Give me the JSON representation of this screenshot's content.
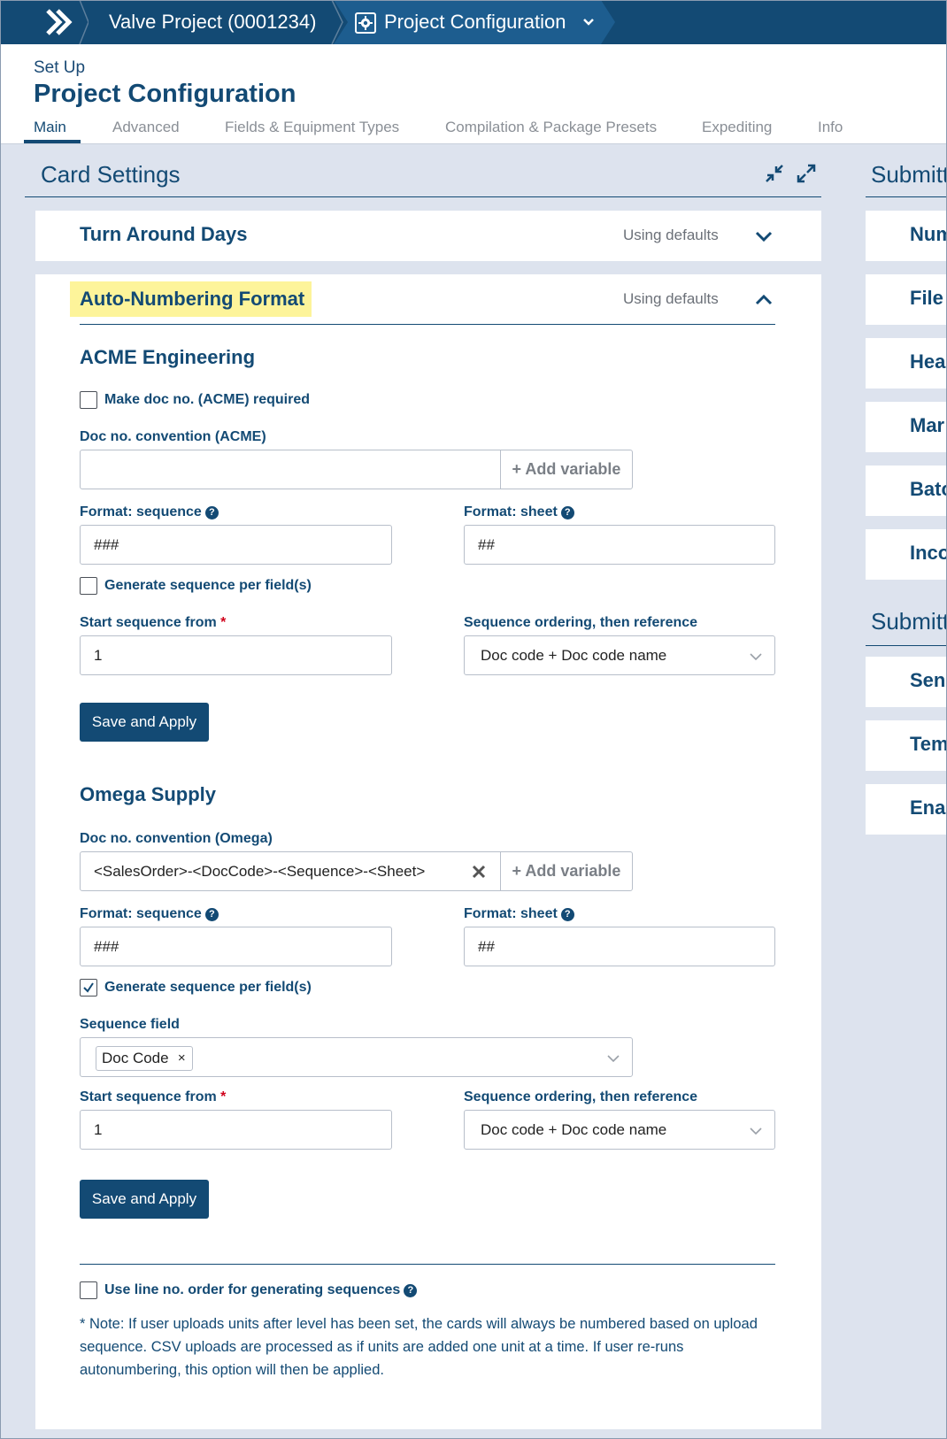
{
  "topbar": {
    "project": "Valve Project (0001234)",
    "page": "Project Configuration"
  },
  "header": {
    "setup": "Set Up",
    "title": "Project Configuration",
    "tabs": [
      "Main",
      "Advanced",
      "Fields & Equipment Types",
      "Compilation & Package Presets",
      "Expediting",
      "Info"
    ]
  },
  "panel": {
    "title": "Card Settings",
    "turn_around": {
      "title": "Turn Around Days",
      "status": "Using defaults"
    },
    "auto_numbering": {
      "title": "Auto-Numbering Format",
      "status": "Using defaults",
      "acme": {
        "title": "ACME Engineering",
        "make_required": "Make doc no. (ACME) required",
        "convention_label": "Doc no. convention (ACME)",
        "convention_value": "",
        "add_variable": "+ Add variable",
        "format_sequence_label": "Format: sequence",
        "format_sequence_value": "###",
        "format_sheet_label": "Format: sheet",
        "format_sheet_value": "##",
        "generate_per_field": "Generate sequence per field(s)",
        "start_label": "Start sequence from",
        "start_value": "1",
        "ordering_label": "Sequence ordering, then reference",
        "ordering_value": "Doc code + Doc code name",
        "save": "Save and Apply"
      },
      "omega": {
        "title": "Omega Supply",
        "convention_label": "Doc no. convention (Omega)",
        "convention_value": "<SalesOrder>-<DocCode>-<Sequence>-<Sheet>",
        "add_variable": "+ Add variable",
        "format_sequence_label": "Format: sequence",
        "format_sequence_value": "###",
        "format_sheet_label": "Format: sheet",
        "format_sheet_value": "##",
        "generate_per_field": "Generate sequence per field(s)",
        "sequence_field_label": "Sequence field",
        "sequence_field_tag": "Doc Code",
        "tag_remove": "×",
        "start_label": "Start sequence from",
        "start_value": "1",
        "ordering_label": "Sequence ordering, then reference",
        "ordering_value": "Doc code + Doc code name",
        "save": "Save and Apply"
      },
      "line_order": "Use line no. order for generating sequences",
      "note": "* Note: If user uploads units after level has been set, the cards will always be numbered based on upload sequence. CSV uploads are processed as if units are added one unit at a time. If user re-runs autonumbering, this option will then be applied."
    }
  },
  "right_panel": {
    "title1": "Submitt",
    "items1": [
      "Num",
      "File",
      "Hea",
      "Mar",
      "Batc",
      "Inco"
    ],
    "title2": "Submitt",
    "items2": [
      "Senc",
      "Tem",
      "Enal"
    ]
  },
  "colors": {
    "primary": "#134a74",
    "topbar_active": "#1d5d8f",
    "highlight": "#fdf49a",
    "background": "#dde3ee"
  }
}
